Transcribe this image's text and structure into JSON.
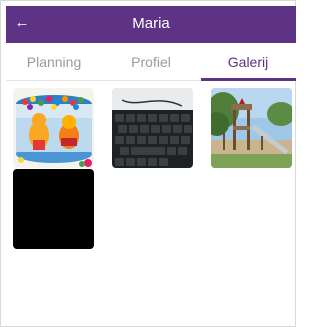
{
  "header": {
    "title": "Maria",
    "back_icon": "arrow-left-icon",
    "back_glyph": "←",
    "color": "#5e3386"
  },
  "tabs": [
    {
      "label": "Planning",
      "active": false
    },
    {
      "label": "Profiel",
      "active": false
    },
    {
      "label": "Galerij",
      "active": true
    }
  ],
  "gallery": {
    "photos": [
      {
        "subject": "colorful toy ball pit"
      },
      {
        "subject": "computer keyboard"
      },
      {
        "subject": "playground slide"
      },
      {
        "subject": "black image"
      }
    ]
  },
  "colors": {
    "accent": "#5e3386",
    "tab_inactive": "#9a9a9a"
  }
}
